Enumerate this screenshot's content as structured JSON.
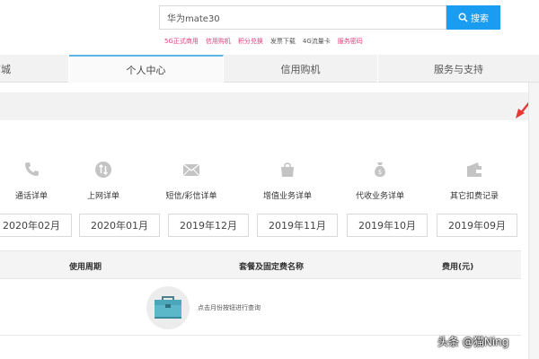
{
  "search": {
    "value": "华为mate30",
    "button_label": "搜索"
  },
  "quick_links": [
    {
      "label": "5G正式商用",
      "color": "#e23c7c"
    },
    {
      "label": "信用购机",
      "color": "#e23c7c"
    },
    {
      "label": "积分兑换",
      "color": "#e23c7c"
    },
    {
      "label": "发票下载",
      "color": "#555555"
    },
    {
      "label": "4G流量卡",
      "color": "#555555"
    },
    {
      "label": "服务密码",
      "color": "#e23c7c"
    }
  ],
  "nav": {
    "tabs": [
      {
        "label": "商城"
      },
      {
        "label": "个人中心",
        "active": true
      },
      {
        "label": "信用购机"
      },
      {
        "label": "服务与支持"
      }
    ]
  },
  "categories": [
    {
      "label": "通话详单",
      "icon": "phone-icon"
    },
    {
      "label": "上网详单",
      "icon": "data-transfer-icon"
    },
    {
      "label": "短信/彩信详单",
      "icon": "envelope-icon"
    },
    {
      "label": "增值业务详单",
      "icon": "shopping-bag-icon"
    },
    {
      "label": "代收业务详单",
      "icon": "money-bag-icon"
    },
    {
      "label": "其它扣费记录",
      "icon": "wallet-icon"
    }
  ],
  "months": [
    "2020年02月",
    "2020年01月",
    "2019年12月",
    "2019年11月",
    "2019年10月",
    "2019年09月"
  ],
  "table": {
    "headers": [
      "使用周期",
      "套餐及固定费名称",
      "费用(元)"
    ],
    "empty_message": "点击月份按钮进行查询"
  },
  "watermark": "头条 @猫Ning",
  "colors": {
    "accent": "#1a9cf0",
    "icon_grey": "#c4c4c4",
    "arrow": "#e53935",
    "nav_active_border": "#5ab4e6"
  }
}
